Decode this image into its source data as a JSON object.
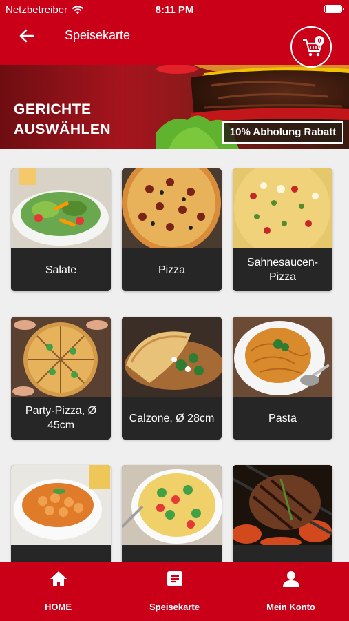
{
  "status_bar": {
    "carrier": "Netzbetreiber",
    "time": "8:11 PM"
  },
  "header": {
    "title": "Speisekarte",
    "cart_count": "0"
  },
  "hero": {
    "title": "GERICHTE AUSWÄHLEN",
    "badge": "10% Abholung Rabatt"
  },
  "categories": [
    {
      "label": "Salate",
      "icon": "salad-image"
    },
    {
      "label": "Pizza",
      "icon": "pizza-image"
    },
    {
      "label": "Sahnesaucen-Pizza",
      "icon": "cream-pizza-image"
    },
    {
      "label": "Party-Pizza, Ø 45cm",
      "icon": "party-pizza-image"
    },
    {
      "label": "Calzone, Ø 28cm",
      "icon": "calzone-image"
    },
    {
      "label": "Pasta",
      "icon": "pasta-image"
    },
    {
      "label": "",
      "icon": "gnocchi-image"
    },
    {
      "label": "",
      "icon": "casserole-image"
    },
    {
      "label": "",
      "icon": "grilled-steak-image"
    }
  ],
  "bottom_nav": [
    {
      "label": "HOME",
      "icon": "home-icon"
    },
    {
      "label": "Speisekarte",
      "icon": "menu-icon"
    },
    {
      "label": "Mein Konto",
      "icon": "account-icon"
    }
  ],
  "colors": {
    "brand_red": "#c90018",
    "card_dark": "#262626"
  }
}
